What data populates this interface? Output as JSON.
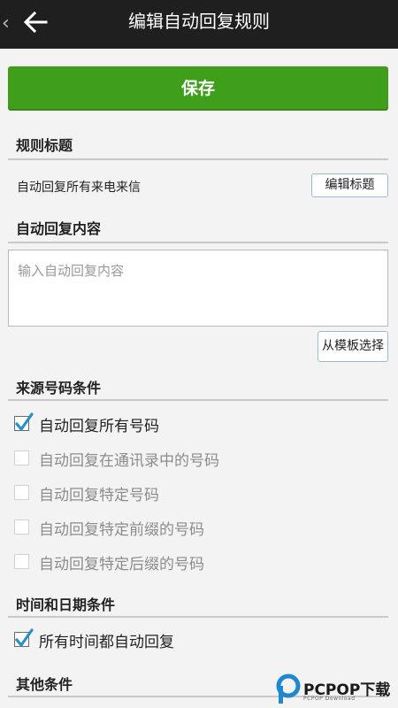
{
  "header": {
    "title": "编辑自动回复规则"
  },
  "actions": {
    "save_label": "保存"
  },
  "rule_title": {
    "section_label": "规则标题",
    "value": "自动回复所有来电来信",
    "edit_button": "编辑标题"
  },
  "reply_content": {
    "section_label": "自动回复内容",
    "placeholder": "输入自动回复内容",
    "value": "",
    "template_button": "从模板选择"
  },
  "source_conditions": {
    "section_label": "来源号码条件",
    "options": [
      {
        "label": "自动回复所有号码",
        "checked": true,
        "enabled": true
      },
      {
        "label": "自动回复在通讯录中的号码",
        "checked": false,
        "enabled": false
      },
      {
        "label": "自动回复特定号码",
        "checked": false,
        "enabled": false
      },
      {
        "label": "自动回复特定前缀的号码",
        "checked": false,
        "enabled": false
      },
      {
        "label": "自动回复特定后缀的号码",
        "checked": false,
        "enabled": false
      }
    ]
  },
  "time_conditions": {
    "section_label": "时间和日期条件",
    "options": [
      {
        "label": "所有时间都自动回复",
        "checked": true,
        "enabled": true
      }
    ]
  },
  "other_conditions": {
    "section_label": "其他条件"
  },
  "watermark": {
    "brand": "PCPOP下载",
    "sub": "PCPOP Download"
  },
  "colors": {
    "accent": "#3f9e1a",
    "topbar": "#1f1f1f",
    "check": "#2a8fc9"
  }
}
